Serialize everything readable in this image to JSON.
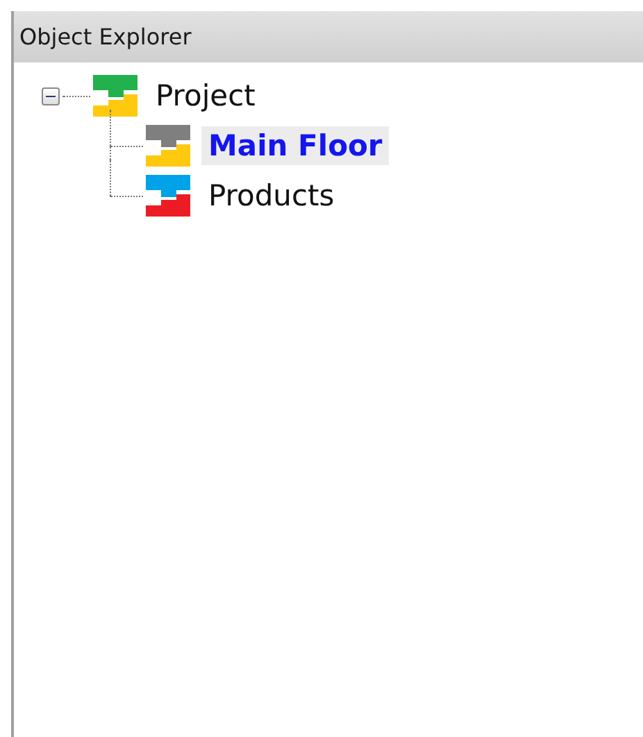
{
  "panel": {
    "title": "Object Explorer"
  },
  "tree": [
    {
      "label": "Project",
      "expanded": true,
      "selected": false,
      "icon_parts": [
        {
          "color": "#22b14c"
        },
        {
          "color": "#ffc90e"
        }
      ],
      "children": [
        {
          "label": "Main Floor",
          "selected": true,
          "icon_parts": [
            {
              "color": "#7f7f7f"
            },
            {
              "color": "#ffc90e"
            }
          ]
        },
        {
          "label": "Products",
          "selected": false,
          "icon_parts": [
            {
              "color": "#00a2e8"
            },
            {
              "color": "#ed1c24"
            }
          ]
        }
      ]
    }
  ]
}
